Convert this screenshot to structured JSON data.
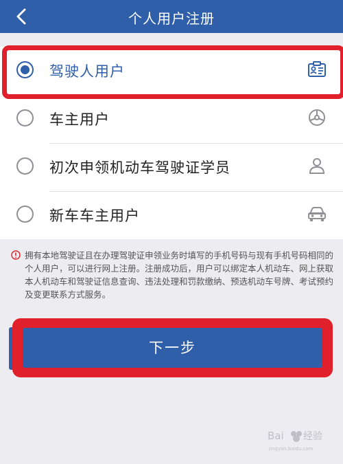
{
  "header": {
    "title": "个人用户注册",
    "back_icon": "back-arrow-icon"
  },
  "options": [
    {
      "label": "驾驶人用户",
      "selected": true,
      "icon": "id-card-icon"
    },
    {
      "label": "车主用户",
      "selected": false,
      "icon": "steering-wheel-icon"
    },
    {
      "label": "初次申领机动车驾驶证学员",
      "selected": false,
      "icon": "person-icon"
    },
    {
      "label": "新车车主用户",
      "selected": false,
      "icon": "car-icon"
    }
  ],
  "note": {
    "icon": "info-icon",
    "text": "拥有本地驾驶证且在办理驾驶证申领业务时填写的手机号码与现有手机号码相同的个人用户，可以进行网上注册。注册成功后，用户可以绑定本人机动车、网上获取本人机动车和驾驶证信息查询、违法处理和罚款缴纳、预选机动车号牌、考试预约及变更联系方式服务。"
  },
  "next_button": {
    "label": "下一步"
  },
  "colors": {
    "primary": "#2f5fa8",
    "highlight": "#e0202a",
    "background": "#ececf1"
  },
  "watermark": {
    "text": "Bai度经验"
  }
}
